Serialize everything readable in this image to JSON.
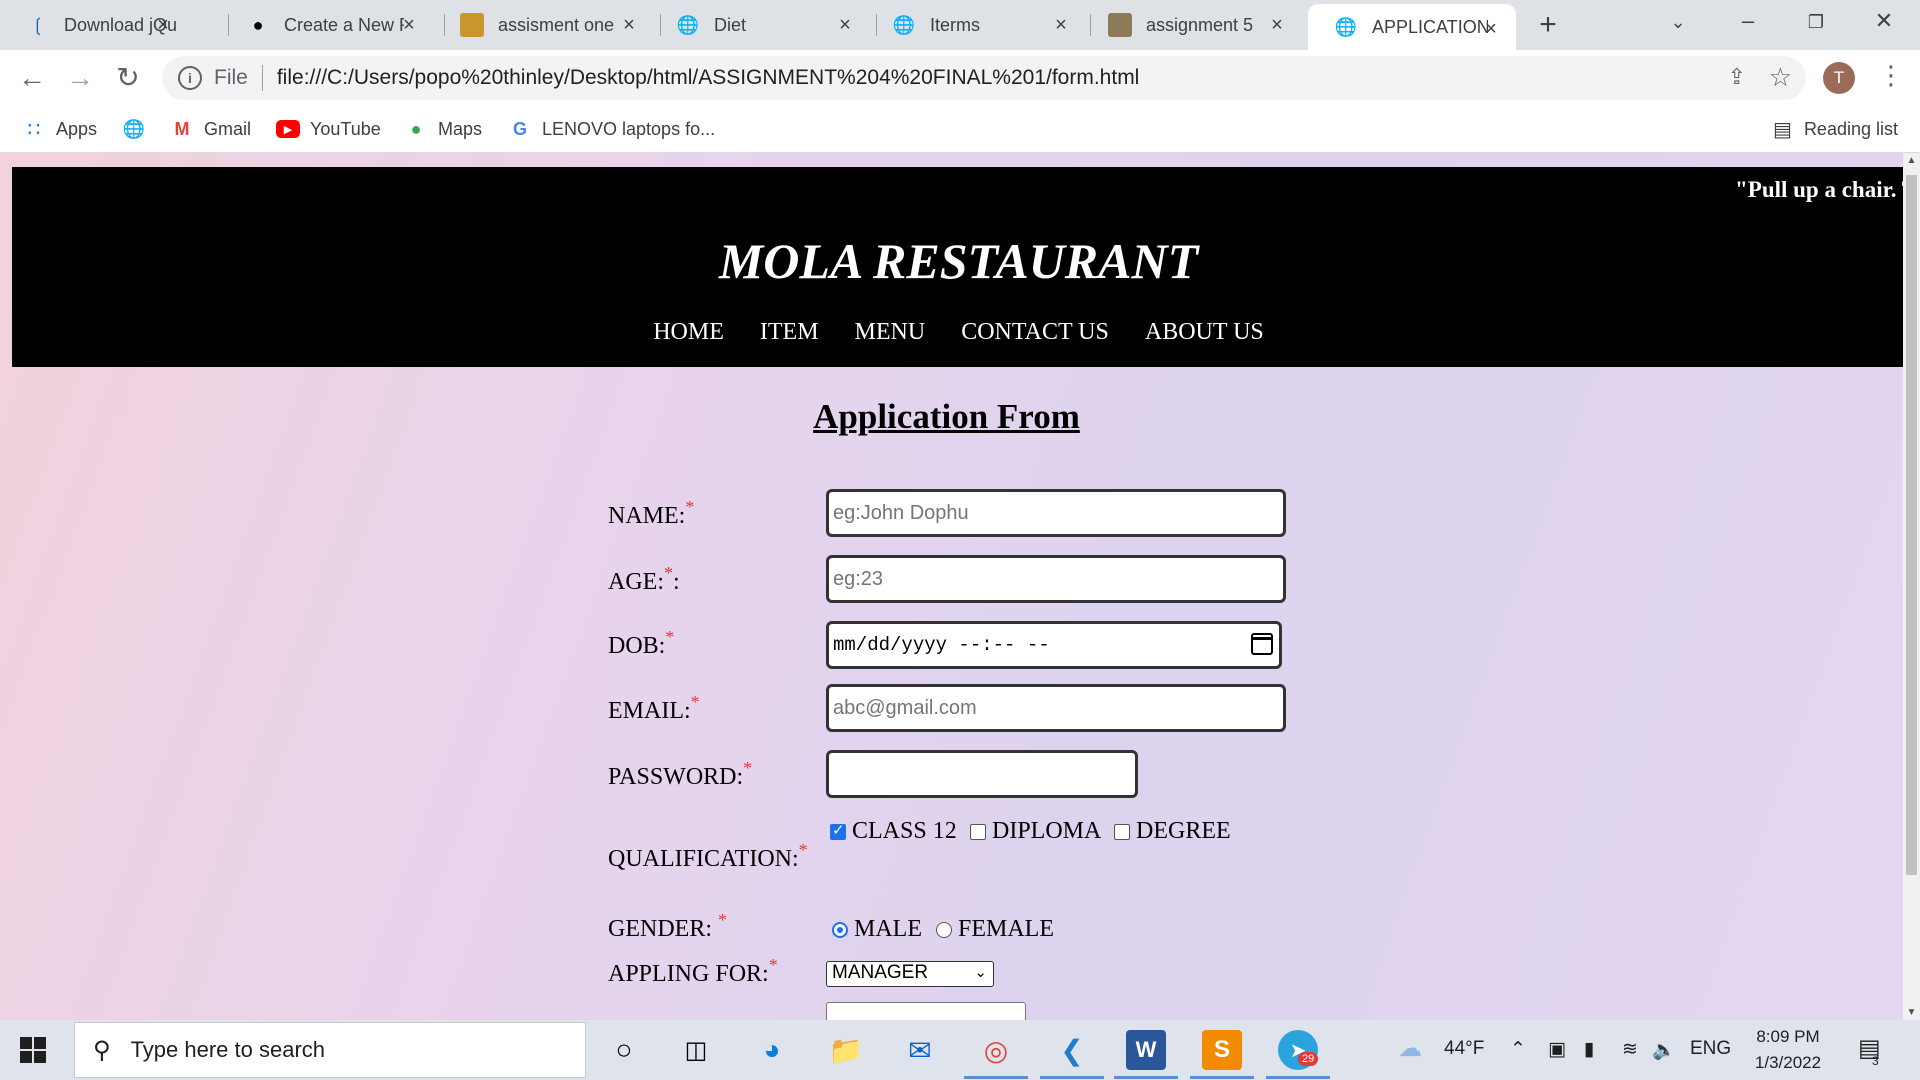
{
  "browser": {
    "tabs": [
      {
        "title": "Download jQue",
        "icon": "jquery-icon"
      },
      {
        "title": "Create a New R",
        "icon": "github-icon"
      },
      {
        "title": "assisment one",
        "icon": "image-favicon-icon"
      },
      {
        "title": "Diet",
        "icon": "globe-icon"
      },
      {
        "title": "Iterms",
        "icon": "globe-icon"
      },
      {
        "title": "assignment 5",
        "icon": "image-favicon-icon"
      },
      {
        "title": "APPLICATION F",
        "icon": "globe-icon",
        "active": true
      }
    ],
    "address": {
      "scheme": "File",
      "url": "file:///C:/Users/popo%20thinley/Desktop/html/ASSIGNMENT%204%20FINAL%201/form.html"
    },
    "profile_initial": "T",
    "bookmarks": [
      {
        "label": "Apps",
        "icon": "apps-grid-icon"
      },
      {
        "label": "",
        "icon": "globe-icon"
      },
      {
        "label": "Gmail",
        "icon": "gmail-icon"
      },
      {
        "label": "YouTube",
        "icon": "youtube-icon"
      },
      {
        "label": "Maps",
        "icon": "maps-pin-icon"
      },
      {
        "label": "LENOVO laptops fo...",
        "icon": "google-icon"
      }
    ],
    "reading_list": "Reading list"
  },
  "page": {
    "marquee": "\"Pull up a chair. T",
    "brand": "MOLA RESTAURANT",
    "nav": [
      "HOME",
      "ITEM",
      "MENU",
      "CONTACT US",
      "ABOUT US"
    ],
    "form_title": "Application From",
    "required_mark": "*",
    "fields": {
      "name_label": "NAME:",
      "name_placeholder": "eg:John Dophu",
      "age_label": "AGE:",
      "age_suffix": ":",
      "age_placeholder": "eg:23",
      "dob_label": "DOB:",
      "dob_value": "mm/dd/yyyy --:-- --",
      "email_label": "EMAIL:",
      "email_placeholder": "abc@gmail.com",
      "password_label": "PASSWORD:",
      "qualification_label": "QUALIFICATION:",
      "qualification_options": [
        {
          "label": "CLASS 12",
          "checked": true
        },
        {
          "label": "DIPLOMA",
          "checked": false
        },
        {
          "label": "DEGREE",
          "checked": false
        }
      ],
      "gender_label": "GENDER:",
      "gender_options": [
        {
          "label": "MALE",
          "selected": true
        },
        {
          "label": "FEMALE",
          "selected": false
        }
      ],
      "applying_label": "APPLING FOR:",
      "applying_value": "MANAGER"
    }
  },
  "taskbar": {
    "search_placeholder": "Type here to search",
    "weather": "44°F",
    "language": "ENG",
    "time": "8:09 PM",
    "date": "1/3/2022",
    "telegram_badge": "29",
    "notification_count": "3"
  },
  "colors": {
    "banner": "#000000",
    "required": "#e53935",
    "accent": "#1a73e8"
  }
}
